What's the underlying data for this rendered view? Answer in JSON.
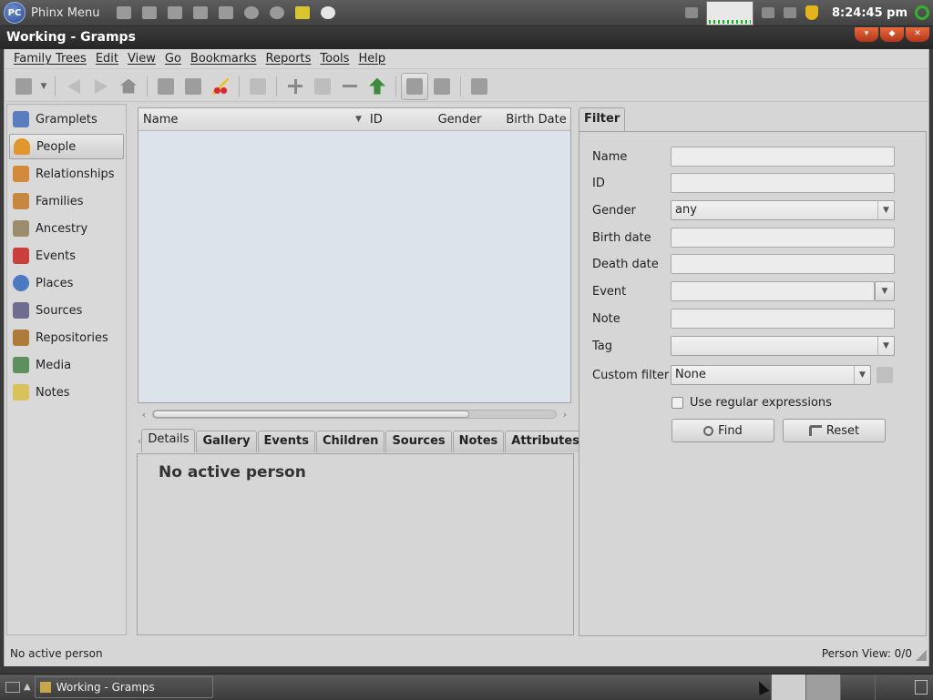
{
  "top_panel": {
    "menu_label": "Phinx Menu",
    "logo_text": "PC",
    "clock": "8:24:45 pm"
  },
  "window": {
    "title": "Working - Gramps"
  },
  "menubar": [
    "Family Trees",
    "Edit",
    "View",
    "Go",
    "Bookmarks",
    "Reports",
    "Tools",
    "Help"
  ],
  "sidebar": {
    "items": [
      {
        "label": "Gramplets",
        "icon": "gramplets-icon",
        "color": "#5b7cbf"
      },
      {
        "label": "People",
        "icon": "people-icon",
        "color": "#e1962d",
        "active": true
      },
      {
        "label": "Relationships",
        "icon": "relationships-icon",
        "color": "#d08a3a"
      },
      {
        "label": "Families",
        "icon": "families-icon",
        "color": "#c88740"
      },
      {
        "label": "Ancestry",
        "icon": "ancestry-icon",
        "color": "#9b8c6e"
      },
      {
        "label": "Events",
        "icon": "events-icon",
        "color": "#c8413b"
      },
      {
        "label": "Places",
        "icon": "places-icon",
        "color": "#4b7ac2"
      },
      {
        "label": "Sources",
        "icon": "sources-icon",
        "color": "#6d6d8f"
      },
      {
        "label": "Repositories",
        "icon": "repositories-icon",
        "color": "#b07a3a"
      },
      {
        "label": "Media",
        "icon": "media-icon",
        "color": "#5e8f5e"
      },
      {
        "label": "Notes",
        "icon": "notes-icon",
        "color": "#d9c25a"
      }
    ]
  },
  "people_list": {
    "columns": [
      "Name",
      "ID",
      "Gender",
      "Birth Date"
    ]
  },
  "tabs": [
    "Details",
    "Gallery",
    "Events",
    "Children",
    "Sources",
    "Notes",
    "Attributes"
  ],
  "details": {
    "message": "No active person"
  },
  "filter": {
    "tab_label": "Filter",
    "name_label": "Name",
    "id_label": "ID",
    "gender_label": "Gender",
    "gender_value": "any",
    "birth_label": "Birth date",
    "death_label": "Death date",
    "event_label": "Event",
    "note_label": "Note",
    "tag_label": "Tag",
    "custom_label": "Custom filter",
    "custom_value": "None",
    "regex_label": "Use regular expressions",
    "find_label": "Find",
    "reset_label": "Reset"
  },
  "status": {
    "left": "No active person",
    "right": "Person View: 0/0"
  },
  "taskbar": {
    "task_label": "Working - Gramps"
  }
}
